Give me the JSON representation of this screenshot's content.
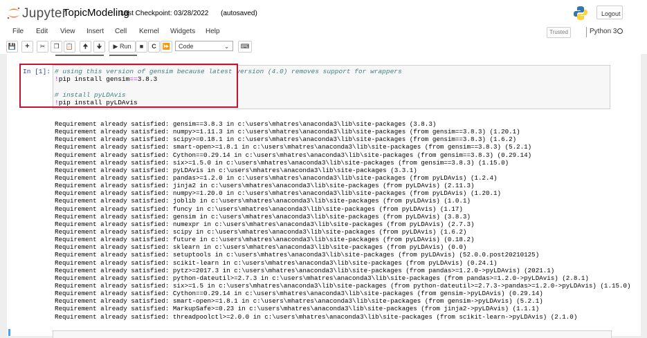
{
  "header": {
    "brand": "Jupyter",
    "notebook_name": "TopicModeling",
    "checkpoint": "Last Checkpoint: 03/28/2022",
    "autosave": "(autosaved)",
    "logout_label": "Logout"
  },
  "menu": {
    "items": [
      "File",
      "Edit",
      "View",
      "Insert",
      "Cell",
      "Kernel",
      "Widgets",
      "Help"
    ],
    "trusted_label": "Trusted",
    "kernel_name": "Python 3"
  },
  "toolbar": {
    "run_label": "Run",
    "cell_type": "Code"
  },
  "cell": {
    "prompt": "In [1]:",
    "lines": [
      "# using this version of gensim because latest version (4.0) removes support for wrappers",
      "!pip install gensim==3.8.3",
      "",
      "# install pyLDAvis",
      "!pip install pyLDAvis"
    ],
    "line1_bang": "!",
    "line1_text": "pip install gensim",
    "line1_op": "==",
    "line1_ver": "3.8.3",
    "line4_bang": "!",
    "line4_text": "pip install pyLDAvis"
  },
  "output": {
    "lines": [
      "Requirement already satisfied: gensim==3.8.3 in c:\\users\\mhatres\\anaconda3\\lib\\site-packages (3.8.3)",
      "Requirement already satisfied: numpy>=1.11.3 in c:\\users\\mhatres\\anaconda3\\lib\\site-packages (from gensim==3.8.3) (1.20.1)",
      "Requirement already satisfied: scipy>=0.18.1 in c:\\users\\mhatres\\anaconda3\\lib\\site-packages (from gensim==3.8.3) (1.6.2)",
      "Requirement already satisfied: smart-open>=1.8.1 in c:\\users\\mhatres\\anaconda3\\lib\\site-packages (from gensim==3.8.3) (5.2.1)",
      "Requirement already satisfied: Cython==0.29.14 in c:\\users\\mhatres\\anaconda3\\lib\\site-packages (from gensim==3.8.3) (0.29.14)",
      "Requirement already satisfied: six>=1.5.0 in c:\\users\\mhatres\\anaconda3\\lib\\site-packages (from gensim==3.8.3) (1.15.0)",
      "Requirement already satisfied: pyLDAvis in c:\\users\\mhatres\\anaconda3\\lib\\site-packages (3.3.1)",
      "Requirement already satisfied: pandas>=1.2.0 in c:\\users\\mhatres\\anaconda3\\lib\\site-packages (from pyLDAvis) (1.2.4)",
      "Requirement already satisfied: jinja2 in c:\\users\\mhatres\\anaconda3\\lib\\site-packages (from pyLDAvis) (2.11.3)",
      "Requirement already satisfied: numpy>=1.20.0 in c:\\users\\mhatres\\anaconda3\\lib\\site-packages (from pyLDAvis) (1.20.1)",
      "Requirement already satisfied: joblib in c:\\users\\mhatres\\anaconda3\\lib\\site-packages (from pyLDAvis) (1.0.1)",
      "Requirement already satisfied: funcy in c:\\users\\mhatres\\anaconda3\\lib\\site-packages (from pyLDAvis) (1.17)",
      "Requirement already satisfied: gensim in c:\\users\\mhatres\\anaconda3\\lib\\site-packages (from pyLDAvis) (3.8.3)",
      "Requirement already satisfied: numexpr in c:\\users\\mhatres\\anaconda3\\lib\\site-packages (from pyLDAvis) (2.7.3)",
      "Requirement already satisfied: scipy in c:\\users\\mhatres\\anaconda3\\lib\\site-packages (from pyLDAvis) (1.6.2)",
      "Requirement already satisfied: future in c:\\users\\mhatres\\anaconda3\\lib\\site-packages (from pyLDAvis) (0.18.2)",
      "Requirement already satisfied: sklearn in c:\\users\\mhatres\\anaconda3\\lib\\site-packages (from pyLDAvis) (0.0)",
      "Requirement already satisfied: setuptools in c:\\users\\mhatres\\anaconda3\\lib\\site-packages (from pyLDAvis) (52.0.0.post20210125)",
      "Requirement already satisfied: scikit-learn in c:\\users\\mhatres\\anaconda3\\lib\\site-packages (from pyLDAvis) (0.24.1)",
      "Requirement already satisfied: pytz>=2017.3 in c:\\users\\mhatres\\anaconda3\\lib\\site-packages (from pandas>=1.2.0->pyLDAvis) (2021.1)",
      "Requirement already satisfied: python-dateutil>=2.7.3 in c:\\users\\mhatres\\anaconda3\\lib\\site-packages (from pandas>=1.2.0->pyLDAvis) (2.8.1)",
      "Requirement already satisfied: six>=1.5 in c:\\users\\mhatres\\anaconda3\\lib\\site-packages (from python-dateutil>=2.7.3->pandas>=1.2.0->pyLDAvis) (1.15.0)",
      "Requirement already satisfied: Cython==0.29.14 in c:\\users\\mhatres\\anaconda3\\lib\\site-packages (from gensim->pyLDAvis) (0.29.14)",
      "Requirement already satisfied: smart-open>=1.8.1 in c:\\users\\mhatres\\anaconda3\\lib\\site-packages (from gensim->pyLDAvis) (5.2.1)",
      "Requirement already satisfied: MarkupSafe>=0.23 in c:\\users\\mhatres\\anaconda3\\lib\\site-packages (from jinja2->pyLDAvis) (1.1.1)",
      "Requirement already satisfied: threadpoolctl>=2.0.0 in c:\\users\\mhatres\\anaconda3\\lib\\site-packages (from scikit-learn->pyLDAvis) (2.1.0)"
    ]
  },
  "colors": {
    "highlight_box": "#c8102e",
    "prompt": "#303f9f",
    "comment": "#408080",
    "magic": "#aa22ff"
  }
}
